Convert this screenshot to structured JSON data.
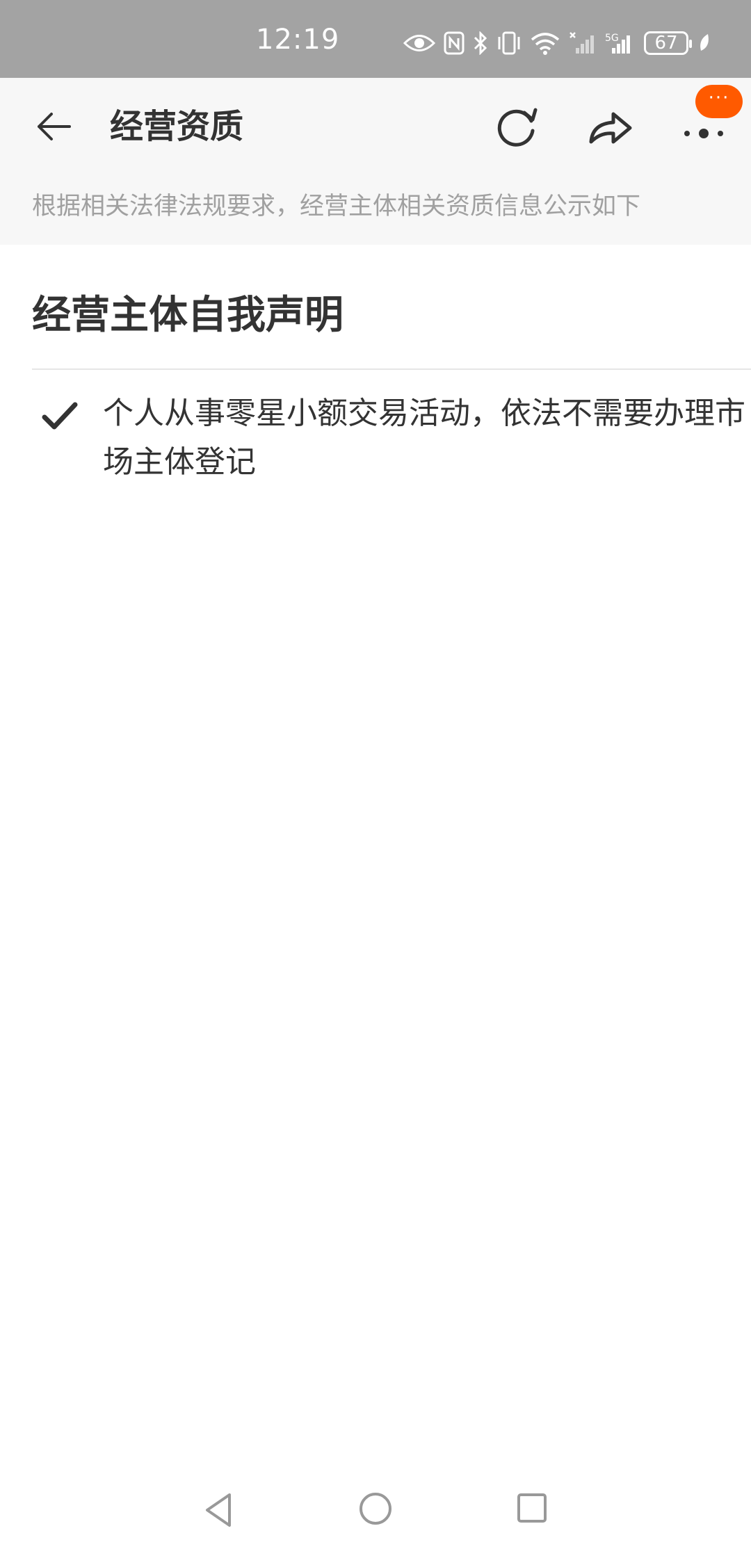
{
  "status_bar": {
    "time": "12:19",
    "battery": "67",
    "icons": [
      "eye-icon",
      "nfc-icon",
      "bluetooth-icon",
      "vibrate-icon",
      "wifi-icon",
      "signal-icon",
      "5g-signal-icon",
      "battery-icon",
      "leaf-icon"
    ]
  },
  "header": {
    "title": "经营资质",
    "notification_bubble": "···",
    "notice": "根据相关法律法规要求，经营主体相关资质信息公示如下",
    "actions": [
      "back-icon",
      "refresh-icon",
      "share-icon",
      "more-icon"
    ]
  },
  "content": {
    "section_title": "经营主体自我声明",
    "statements": [
      {
        "text": "个人从事零星小额交易活动，依法不需要办理市场主体登记",
        "icon": "check-icon"
      }
    ]
  },
  "nav_bar": {
    "buttons": [
      "nav-back-icon",
      "nav-home-icon",
      "nav-recent-icon"
    ]
  },
  "colors": {
    "status_bar_bg": "#a3a3a3",
    "header_bg": "#f7f7f7",
    "accent": "#ff5a00",
    "text_primary": "#333333",
    "text_secondary": "#a0a0a0"
  }
}
